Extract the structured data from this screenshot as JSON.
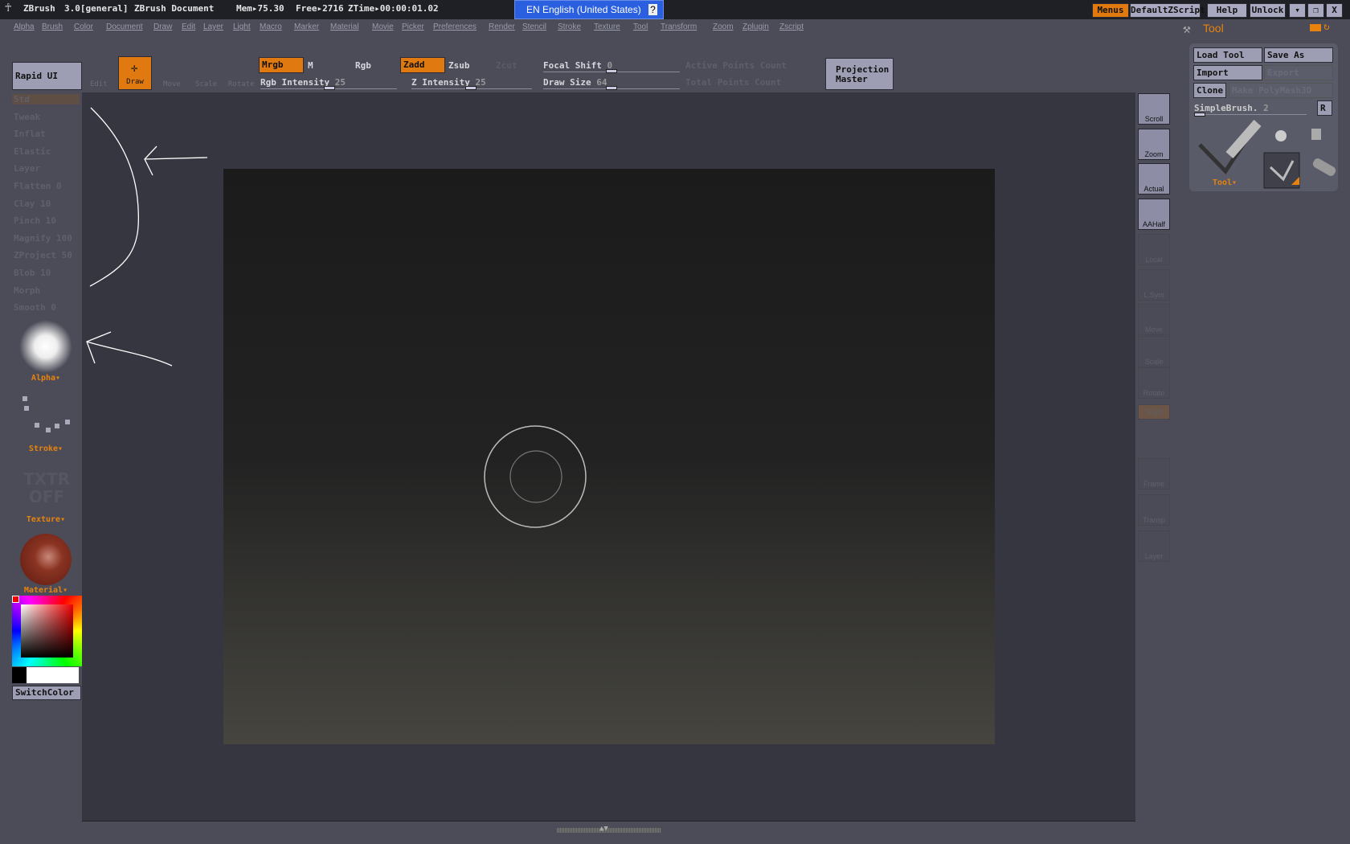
{
  "titlebar": {
    "app": "ZBrush",
    "version": "3.0[general]",
    "document": "ZBrush Document",
    "mem": "Mem▸75.30",
    "free": "Free▸2716",
    "ztime": "ZTime▸00:00:01.02",
    "language": "EN English (United States)",
    "buttons": [
      "Menus",
      "DefaultZScript",
      "Help",
      "Unlock"
    ],
    "window_controls": [
      "minimize",
      "restore",
      "close"
    ]
  },
  "menus": [
    "Alpha",
    "Brush",
    "Color",
    "Document",
    "Draw",
    "Edit",
    "Layer",
    "Light",
    "Macro",
    "Marker",
    "Material",
    "Movie",
    "Picker",
    "Preferences",
    "Render",
    "Stencil",
    "Stroke",
    "Texture",
    "Tool",
    "Transform",
    "Zoom",
    "Zplugin",
    "Zscript"
  ],
  "toolbar": {
    "rapid_ui": "Rapid UI",
    "modes": [
      "Edit",
      "Draw",
      "Move",
      "Scale",
      "Rotate"
    ],
    "mrgb": "Mrgb",
    "m": "M",
    "rgb": "Rgb",
    "zadd": "Zadd",
    "zsub": "Zsub",
    "zcut": "Zcut",
    "focal_shift": "Focal Shift",
    "focal_shift_value": "0",
    "rgb_intensity": "Rgb Intensity",
    "rgb_intensity_value": "25",
    "z_intensity": "Z Intensity",
    "z_intensity_value": "25",
    "draw_size": "Draw Size",
    "draw_size_value": "64",
    "active_points": "Active Points Count",
    "total_points": "Total Points Count",
    "projection_master": "Projection Master"
  },
  "left": {
    "brushes": [
      "Std",
      "Tweak",
      "Inflat",
      "Elastic",
      "Layer",
      "Flatten 0",
      "Clay 10",
      "Pinch 10",
      "Magnify 100",
      "ZProject 50",
      "Blob 10",
      "Morph",
      "Smooth 0"
    ],
    "alpha": "Alpha",
    "stroke": "Stroke",
    "texture_off": "TXTR OFF",
    "texture": "Texture",
    "material": "Material",
    "switch_color": "SwitchColor",
    "material_color": "#8a3322",
    "main_color": "#e00000",
    "secondary_color": "#000000"
  },
  "shelf": [
    "Scroll",
    "Zoom",
    "Actual",
    "AAHalf",
    "Local",
    "L.Sym",
    "Move",
    "Scale",
    "Rotate",
    "Gxyz",
    "Frame",
    "Transp",
    "Layer"
  ],
  "tool": {
    "title": "Tool",
    "load": "Load Tool",
    "save": "Save As",
    "import": "Import",
    "export": "Export",
    "clone": "Clone",
    "make_polymesh": "Make PolyMesh3D",
    "brush": "SimpleBrush.",
    "brush_value": "2",
    "r": "R",
    "tool_label": "Tool"
  }
}
